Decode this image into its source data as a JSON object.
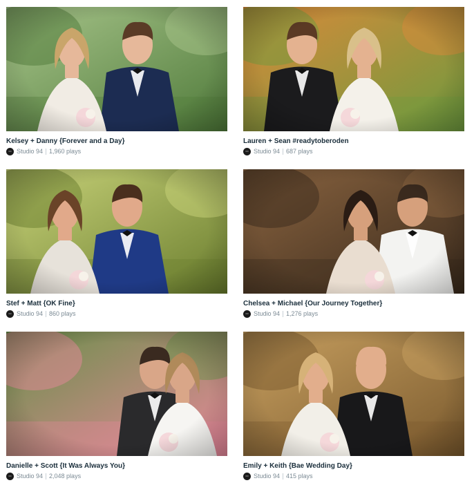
{
  "videos": [
    {
      "title": "Kelsey + Danny {Forever and a Day}",
      "studio": "Studio 94",
      "plays": "1,960 plays",
      "palette": {
        "bg": "#4f7a3a",
        "bg2": "#a7c48a",
        "dress": "#f1ece4",
        "suit": "#1c2c52",
        "skin": "#e6b89a",
        "hair": "#c9a56a",
        "hair2": "#5a3b26"
      }
    },
    {
      "title": "Lauren + Sean #readytoberoden",
      "studio": "Studio 94",
      "plays": "687 plays",
      "palette": {
        "bg": "#6f9a3e",
        "bg2": "#d98a3a",
        "dress": "#f4f1ea",
        "suit": "#1b1b1d",
        "skin": "#e4b290",
        "hair": "#d9c08a",
        "hair2": "#5b3a24"
      }
    },
    {
      "title": "Stef + Matt {OK Fine}",
      "studio": "Studio 94",
      "plays": "860 plays",
      "palette": {
        "bg": "#6a7d2e",
        "bg2": "#c9d37a",
        "dress": "#e7e2da",
        "suit": "#1f3a86",
        "skin": "#e1a98a",
        "hair": "#6a4328",
        "hair2": "#4a2f1e"
      }
    },
    {
      "title": "Chelsea + Michael {Our Journey Together}",
      "studio": "Studio 94",
      "plays": "1,276 plays",
      "palette": {
        "bg": "#3a2a1c",
        "bg2": "#8a6440",
        "dress": "#e9ddd0",
        "suit": "#f3f3f1",
        "skin": "#d6a07c",
        "hair": "#2a1c14",
        "hair2": "#3a2a1e"
      }
    },
    {
      "title": "Danielle + Scott {It Was Always You}",
      "studio": "Studio 94",
      "plays": "2,048 plays",
      "palette": {
        "bg": "#e6889a",
        "bg2": "#6a8f4a",
        "dress": "#f6f5f2",
        "suit": "#2a2a2c",
        "skin": "#d9a688",
        "hair": "#b08a5a",
        "hair2": "#3a2a20"
      }
    },
    {
      "title": "Emily + Keith {Bae Wedding Day}",
      "studio": "Studio 94",
      "plays": "415 plays",
      "palette": {
        "bg": "#7a5a2e",
        "bg2": "#c8a060",
        "dress": "#f2efe8",
        "suit": "#18181a",
        "skin": "#e2ae8c",
        "hair": "#d6b278",
        "hair2": "#e2ae8c"
      }
    }
  ]
}
